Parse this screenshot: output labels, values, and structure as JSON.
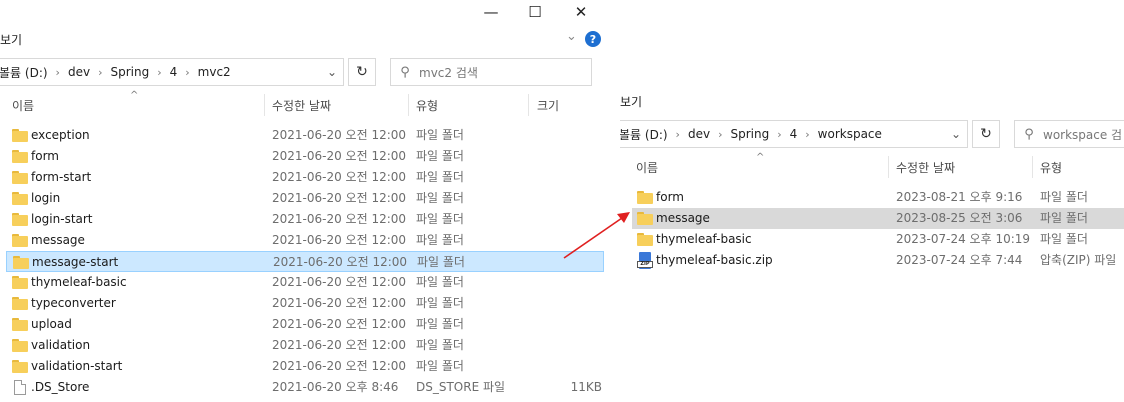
{
  "left": {
    "caption": {
      "minimize": "—",
      "maximize": "☐",
      "close": "✕"
    },
    "ribbon_label": "보기",
    "ribbon_chevron": "⌄",
    "help": "?",
    "address": {
      "crumbs": [
        "볼륨 (D:)",
        "dev",
        "Spring",
        "4",
        "mvc2"
      ],
      "dropdown": "⌄"
    },
    "refresh": "↻",
    "search_placeholder": "mvc2 검색",
    "search_icon": "⚲",
    "headers": {
      "name": "이름",
      "date": "수정한 날짜",
      "type": "유형",
      "size": "크기"
    },
    "sort_arrow": "^",
    "rows": [
      {
        "name": "exception",
        "date": "2021-06-20 오전 12:00",
        "type": "파일 폴더",
        "size": "",
        "icon": "folder-icon"
      },
      {
        "name": "form",
        "date": "2021-06-20 오전 12:00",
        "type": "파일 폴더",
        "size": "",
        "icon": "folder-icon"
      },
      {
        "name": "form-start",
        "date": "2021-06-20 오전 12:00",
        "type": "파일 폴더",
        "size": "",
        "icon": "folder-icon"
      },
      {
        "name": "login",
        "date": "2021-06-20 오전 12:00",
        "type": "파일 폴더",
        "size": "",
        "icon": "folder-icon"
      },
      {
        "name": "login-start",
        "date": "2021-06-20 오전 12:00",
        "type": "파일 폴더",
        "size": "",
        "icon": "folder-icon"
      },
      {
        "name": "message",
        "date": "2021-06-20 오전 12:00",
        "type": "파일 폴더",
        "size": "",
        "icon": "folder-icon"
      },
      {
        "name": "message-start",
        "date": "2021-06-20 오전 12:00",
        "type": "파일 폴더",
        "size": "",
        "icon": "folder-icon",
        "selected": true
      },
      {
        "name": "thymeleaf-basic",
        "date": "2021-06-20 오전 12:00",
        "type": "파일 폴더",
        "size": "",
        "icon": "folder-icon"
      },
      {
        "name": "typeconverter",
        "date": "2021-06-20 오전 12:00",
        "type": "파일 폴더",
        "size": "",
        "icon": "folder-icon"
      },
      {
        "name": "upload",
        "date": "2021-06-20 오전 12:00",
        "type": "파일 폴더",
        "size": "",
        "icon": "folder-icon"
      },
      {
        "name": "validation",
        "date": "2021-06-20 오전 12:00",
        "type": "파일 폴더",
        "size": "",
        "icon": "folder-icon"
      },
      {
        "name": "validation-start",
        "date": "2021-06-20 오전 12:00",
        "type": "파일 폴더",
        "size": "",
        "icon": "folder-icon"
      },
      {
        "name": ".DS_Store",
        "date": "2021-06-20 오후 8:46",
        "type": "DS_STORE 파일",
        "size": "11KB",
        "icon": "file-icon"
      }
    ]
  },
  "right": {
    "ribbon_label": "보기",
    "address": {
      "crumbs": [
        "볼륨 (D:)",
        "dev",
        "Spring",
        "4",
        "workspace"
      ],
      "dropdown": "⌄"
    },
    "refresh": "↻",
    "search_placeholder": "workspace 검",
    "search_icon": "⚲",
    "headers": {
      "name": "이름",
      "date": "수정한 날짜",
      "type": "유형"
    },
    "sort_arrow": "^",
    "rows": [
      {
        "name": "form",
        "date": "2023-08-21 오후 9:16",
        "type": "파일 폴더",
        "icon": "folder-icon"
      },
      {
        "name": "message",
        "date": "2023-08-25 오전 3:06",
        "type": "파일 폴더",
        "icon": "folder-icon",
        "highlighted": true
      },
      {
        "name": "thymeleaf-basic",
        "date": "2023-07-24 오후 10:19",
        "type": "파일 폴더",
        "icon": "folder-icon"
      },
      {
        "name": "thymeleaf-basic.zip",
        "date": "2023-07-24 오후 7:44",
        "type": "압축(ZIP) 파일",
        "icon": "zip-icon"
      }
    ]
  },
  "colors": {
    "selection": "#cce8ff",
    "selection_border": "#99d1ff",
    "highlight": "#d9d9d9",
    "arrow": "#e02020",
    "folder": "#f7cf5b"
  }
}
